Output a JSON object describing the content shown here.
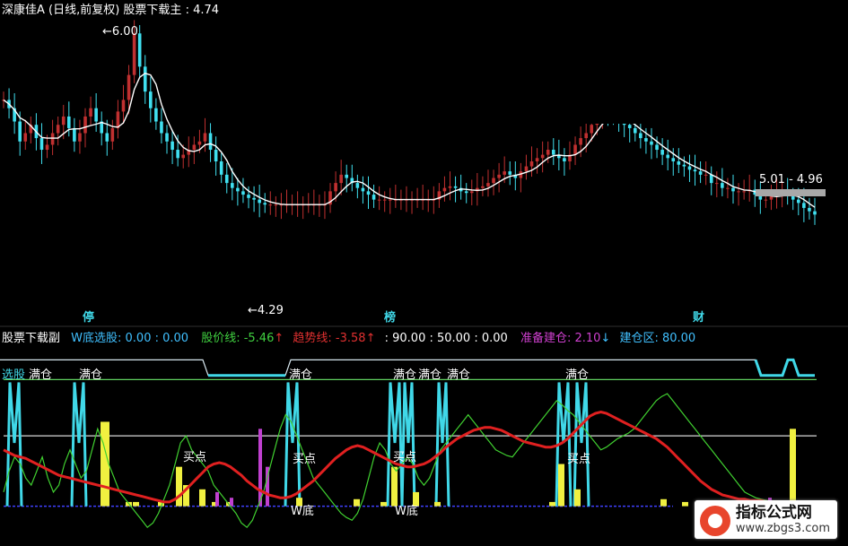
{
  "colors": {
    "background": "#000000",
    "up_candle": "#c03030",
    "down_candle": "#40e0f0",
    "ma_white": "#ffffff",
    "wave_cyan": "#40d8e8",
    "curve_red": "#e02020",
    "curve_green": "#40d030",
    "bar_yellow": "#f0f040",
    "bar_purple": "#c040d0",
    "line_green": "#60d060",
    "line_white": "#d8d8d8",
    "line_blue_dash": "#4040ff",
    "main_title": "#ffffff",
    "sub_title": "#ffffff",
    "sub_select": "#40c0ff",
    "sub_price": "#40d040",
    "sub_trend": "#e03030",
    "sub_prep": "#d040d0",
    "sub_build": "#40c0ff",
    "events": "#40d8e8"
  },
  "main_panel": {
    "title": "深康佳A (日线,前复权) 股票下载主 : 4.74",
    "high_marker": "6.00",
    "low_marker": "4.29",
    "range_label": "5.01 - 4.96",
    "events": [
      "停",
      "榜",
      "财"
    ]
  },
  "sub_panel": {
    "title": "股票下载副",
    "select_label": "W底选股: 0.00 : 0.00",
    "price_line_label": "股价线: -5.46",
    "price_arrow": "↑",
    "trend_label": "趋势线: -3.58",
    "trend_arrow": "↑",
    "levels_label": ": 90.00 : 50.00 : 0.00",
    "prep_label": "准备建仓: 2.10",
    "prep_arrow": "↓",
    "build_label": "建仓区: 80.00",
    "annotations": [
      "选股",
      "满仓",
      "满仓",
      "满仓",
      "满仓",
      "满仓",
      "满仓",
      "满仓",
      "买点",
      "买点",
      "买点",
      "买点",
      "W底",
      "W底"
    ]
  },
  "watermark": {
    "title": "指标公式网",
    "url": "www.zbgs3.com"
  },
  "chart_data": [
    {
      "type": "candlestick",
      "title": "深康佳A (日线,前复权) 股票下载主 : 4.74",
      "x": [
        1,
        2,
        3,
        4,
        5,
        6,
        7,
        8,
        9,
        10,
        11,
        12,
        13,
        14,
        15,
        16,
        17,
        18,
        19,
        20,
        21,
        22,
        23,
        24,
        25,
        26,
        27,
        28,
        29,
        30,
        31,
        32,
        33,
        34,
        35,
        36,
        37,
        38,
        39,
        40,
        41,
        42,
        43,
        44,
        45,
        46,
        47,
        48,
        49,
        50,
        51,
        52,
        53,
        54,
        55,
        56,
        57,
        58,
        59,
        60,
        61,
        62,
        63,
        64,
        65,
        66,
        67,
        68,
        69,
        70,
        71,
        72,
        73,
        74,
        75,
        76,
        77,
        78,
        79,
        80,
        81,
        82,
        83,
        84,
        85,
        86,
        87,
        88,
        89,
        90,
        91,
        92,
        93,
        94,
        95,
        96,
        97,
        98,
        99,
        100,
        101,
        102,
        103,
        104,
        105,
        106,
        107,
        108,
        109,
        110,
        111,
        112,
        113,
        114,
        115,
        116,
        117,
        118,
        119,
        120,
        121,
        122,
        123,
        124,
        125,
        126,
        127,
        128,
        129,
        130,
        131,
        132,
        133,
        134,
        135,
        136,
        137,
        138,
        139,
        140,
        141,
        142,
        143,
        144,
        145,
        146,
        147,
        148,
        149,
        150
      ],
      "close": [
        5.55,
        5.5,
        5.42,
        5.3,
        5.35,
        5.4,
        5.32,
        5.25,
        5.28,
        5.35,
        5.4,
        5.45,
        5.38,
        5.3,
        5.35,
        5.45,
        5.5,
        5.42,
        5.35,
        5.3,
        5.38,
        5.48,
        5.55,
        5.7,
        5.95,
        5.75,
        5.6,
        5.5,
        5.42,
        5.35,
        5.3,
        5.25,
        5.2,
        5.22,
        5.25,
        5.28,
        5.3,
        5.35,
        5.25,
        5.18,
        5.1,
        5.05,
        5.02,
        5.0,
        4.98,
        4.96,
        4.95,
        4.93,
        4.92,
        4.92,
        4.92,
        4.92,
        4.92,
        4.92,
        4.92,
        4.92,
        4.92,
        4.92,
        4.92,
        4.92,
        5.0,
        5.05,
        5.1,
        5.08,
        5.05,
        5.02,
        5.0,
        4.98,
        4.95,
        4.95,
        4.95,
        4.95,
        4.95,
        4.95,
        4.95,
        4.95,
        4.95,
        4.95,
        4.95,
        4.95,
        5.0,
        5.02,
        5.03,
        5.02,
        5.0,
        4.99,
        5.0,
        5.02,
        5.03,
        5.05,
        5.08,
        5.1,
        5.12,
        5.1,
        5.08,
        5.12,
        5.15,
        5.18,
        5.2,
        5.22,
        5.25,
        5.22,
        5.2,
        5.18,
        5.22,
        5.28,
        5.32,
        5.35,
        5.4,
        5.45,
        5.5,
        5.48,
        5.45,
        5.42,
        5.4,
        5.38,
        5.35,
        5.32,
        5.3,
        5.28,
        5.25,
        5.22,
        5.2,
        5.18,
        5.16,
        5.15,
        5.13,
        5.12,
        5.1,
        5.1,
        5.05,
        5.05,
        5.02,
        5.02,
        5.0,
        5.0,
        5.0,
        5.01,
        4.98,
        4.95,
        4.95,
        4.97,
        4.99,
        5.0,
        4.97,
        4.95,
        4.93,
        4.9,
        4.88,
        4.86
      ]
    },
    {
      "type": "line",
      "title": "股票下载副",
      "ylim": [
        -20,
        110
      ],
      "levels": [
        90,
        50,
        0
      ],
      "series": [
        {
          "name": "股价线",
          "values": [
            10,
            25,
            35,
            30,
            20,
            15,
            25,
            35,
            20,
            10,
            15,
            30,
            40,
            30,
            20,
            25,
            40,
            55,
            45,
            30,
            20,
            10,
            5,
            0,
            -5,
            -10,
            -15,
            -12,
            -5,
            5,
            15,
            30,
            45,
            50,
            40,
            35,
            30,
            25,
            15,
            10,
            5,
            0,
            -5,
            -12,
            -15,
            -10,
            0,
            10,
            25,
            40,
            55,
            65,
            60,
            50,
            40,
            30,
            20,
            15,
            10,
            5,
            0,
            -5,
            -8,
            -10,
            -5,
            5,
            20,
            35,
            45,
            40,
            30,
            25,
            30,
            35,
            30,
            20,
            15,
            20,
            30,
            40,
            45,
            50,
            55,
            60,
            65,
            60,
            55,
            50,
            45,
            40,
            38,
            36,
            35,
            40,
            45,
            50,
            55,
            60,
            65,
            70,
            75,
            72,
            68,
            65,
            60,
            55,
            50,
            45,
            40,
            42,
            45,
            48,
            50,
            52,
            55,
            60,
            65,
            70,
            75,
            78,
            80,
            75,
            70,
            65,
            60,
            55,
            50,
            45,
            40,
            35,
            30,
            25,
            20,
            15,
            10,
            8,
            6,
            5,
            4,
            3,
            2,
            1,
            0,
            -1,
            -2,
            -3,
            -4,
            -5
          ]
        },
        {
          "name": "趋势线",
          "values": [
            40,
            38,
            36,
            35,
            34,
            32,
            30,
            28,
            26,
            24,
            22,
            21,
            20,
            19,
            18,
            17,
            16,
            15,
            14,
            13,
            12,
            11,
            10,
            9,
            8,
            7,
            6,
            5,
            4,
            3,
            3,
            5,
            8,
            12,
            16,
            20,
            24,
            28,
            30,
            31,
            30,
            28,
            25,
            22,
            18,
            15,
            12,
            10,
            8,
            7,
            6,
            6,
            7,
            9,
            12,
            15,
            18,
            22,
            26,
            30,
            34,
            37,
            40,
            42,
            43,
            42,
            40,
            38,
            36,
            34,
            32,
            30,
            29,
            28,
            28,
            29,
            30,
            32,
            35,
            38,
            42,
            45,
            48,
            50,
            52,
            54,
            55,
            56,
            56,
            55,
            54,
            52,
            50,
            48,
            46,
            45,
            44,
            43,
            42,
            42,
            43,
            45,
            48,
            52,
            56,
            60,
            64,
            66,
            67,
            66,
            64,
            62,
            60,
            58,
            56,
            54,
            52,
            50,
            48,
            45,
            42,
            38,
            34,
            30,
            26,
            22,
            18,
            15,
            12,
            10,
            8,
            7,
            6,
            5,
            5,
            4,
            4,
            4,
            3,
            3,
            3,
            3,
            3,
            3,
            3,
            3,
            3,
            3,
            3,
            3
          ]
        },
        {
          "name": "W底选股",
          "values": [
            0,
            0,
            0,
            0,
            0,
            0,
            0,
            0,
            0,
            0,
            0,
            0,
            0,
            0,
            0,
            0,
            0,
            0,
            0,
            0,
            0,
            0,
            0,
            0,
            0,
            0,
            0,
            0,
            0,
            0,
            0,
            0,
            0,
            0,
            0,
            0,
            0,
            0,
            0,
            0,
            0,
            0,
            0,
            0,
            0,
            0,
            0,
            0,
            0,
            0,
            0,
            0,
            0,
            0,
            0,
            0,
            0,
            0,
            0,
            0,
            0,
            0,
            0,
            0,
            0,
            0,
            0,
            0,
            0,
            0,
            0,
            0,
            0,
            0,
            0,
            0,
            0,
            0,
            0,
            0,
            0,
            0,
            0,
            0,
            0,
            0,
            0,
            0,
            0,
            0,
            0,
            0,
            0,
            0,
            0,
            0,
            0,
            0,
            0,
            0,
            0,
            0,
            0,
            0,
            0,
            0,
            0,
            0,
            0,
            0,
            0,
            0,
            0,
            0,
            0,
            0,
            0,
            0,
            0,
            0,
            0,
            0,
            0,
            0,
            0,
            0,
            0,
            0,
            0,
            0,
            0,
            0,
            0,
            0,
            0,
            0,
            0,
            0,
            0,
            0,
            0,
            0,
            0,
            0,
            0,
            0,
            0,
            0,
            0,
            0
          ]
        }
      ],
      "bars": [
        {
          "name": "准备建仓",
          "x": [
            18,
            19,
            20,
            21,
            22,
            23,
            24,
            25,
            26,
            27,
            28,
            29,
            30,
            31,
            32,
            33,
            34,
            35,
            36,
            37,
            38,
            39,
            40,
            41,
            42,
            43,
            44,
            45,
            46,
            47,
            48,
            49,
            50,
            51,
            52,
            53,
            54,
            55,
            56,
            57,
            58,
            59,
            60,
            61,
            62,
            63,
            64,
            65,
            66,
            67,
            68,
            69,
            70,
            71,
            72,
            73,
            74,
            75,
            76,
            77,
            78,
            79,
            80,
            81,
            82,
            83,
            84,
            85,
            86,
            87,
            88,
            89,
            90,
            91,
            92,
            93,
            94,
            95,
            96,
            97,
            98,
            99,
            100,
            101,
            102,
            103,
            104,
            105,
            106,
            107,
            108,
            109,
            110,
            111,
            112,
            113,
            114,
            115,
            116,
            117,
            118,
            119,
            120,
            121,
            122,
            123,
            124,
            125,
            126,
            127,
            128,
            129,
            130,
            131,
            132,
            133,
            134,
            135,
            136,
            137,
            138,
            139,
            140,
            141,
            142,
            143,
            144,
            145,
            146,
            147,
            148,
            149,
            150
          ],
          "values": [
            0,
            0,
            0,
            0,
            0,
            0,
            0,
            0,
            0,
            0,
            0,
            0,
            0,
            0,
            0,
            0,
            0,
            0,
            0,
            0,
            0,
            0,
            0,
            0,
            0,
            0,
            0,
            0,
            0,
            0,
            0,
            0,
            0,
            0,
            0,
            0,
            0,
            0,
            0,
            0,
            0,
            0,
            0,
            0,
            0,
            0,
            0,
            0,
            0,
            0,
            0,
            0,
            0,
            0,
            0,
            0,
            0,
            0,
            0,
            0,
            0,
            0,
            0,
            0,
            0,
            0,
            0,
            0,
            0,
            0,
            0,
            0,
            0,
            0,
            0,
            0,
            0,
            0,
            0,
            0,
            0,
            0,
            0,
            0,
            0,
            0,
            0,
            0,
            0,
            0,
            0,
            0,
            0,
            0,
            0,
            0,
            0,
            0,
            0,
            0,
            0,
            0,
            0,
            0,
            0,
            0,
            0,
            0,
            0,
            0,
            0,
            0,
            0,
            0,
            0,
            0,
            0,
            0,
            0,
            0,
            0,
            0,
            0,
            0,
            0,
            0,
            0,
            0,
            0,
            0,
            0,
            0,
            0,
            0
          ]
        },
        {
          "name": "建仓区",
          "values": [
            80
          ]
        }
      ]
    }
  ]
}
